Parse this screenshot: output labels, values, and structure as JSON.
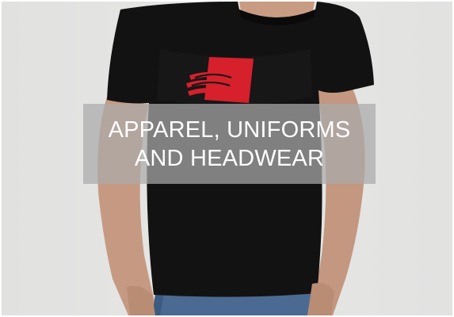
{
  "tile": {
    "caption_line_1": "APPAREL, UNIFORMS",
    "caption_line_2": "AND HEADWEAR"
  },
  "colors": {
    "background": "#e4e4e3",
    "shirt": "#111111",
    "logo_red": "#d6202c",
    "caption_text": "#ffffff",
    "caption_panel": "#aaaaaa"
  },
  "icons": {
    "logo": "wave-flag-logo"
  }
}
